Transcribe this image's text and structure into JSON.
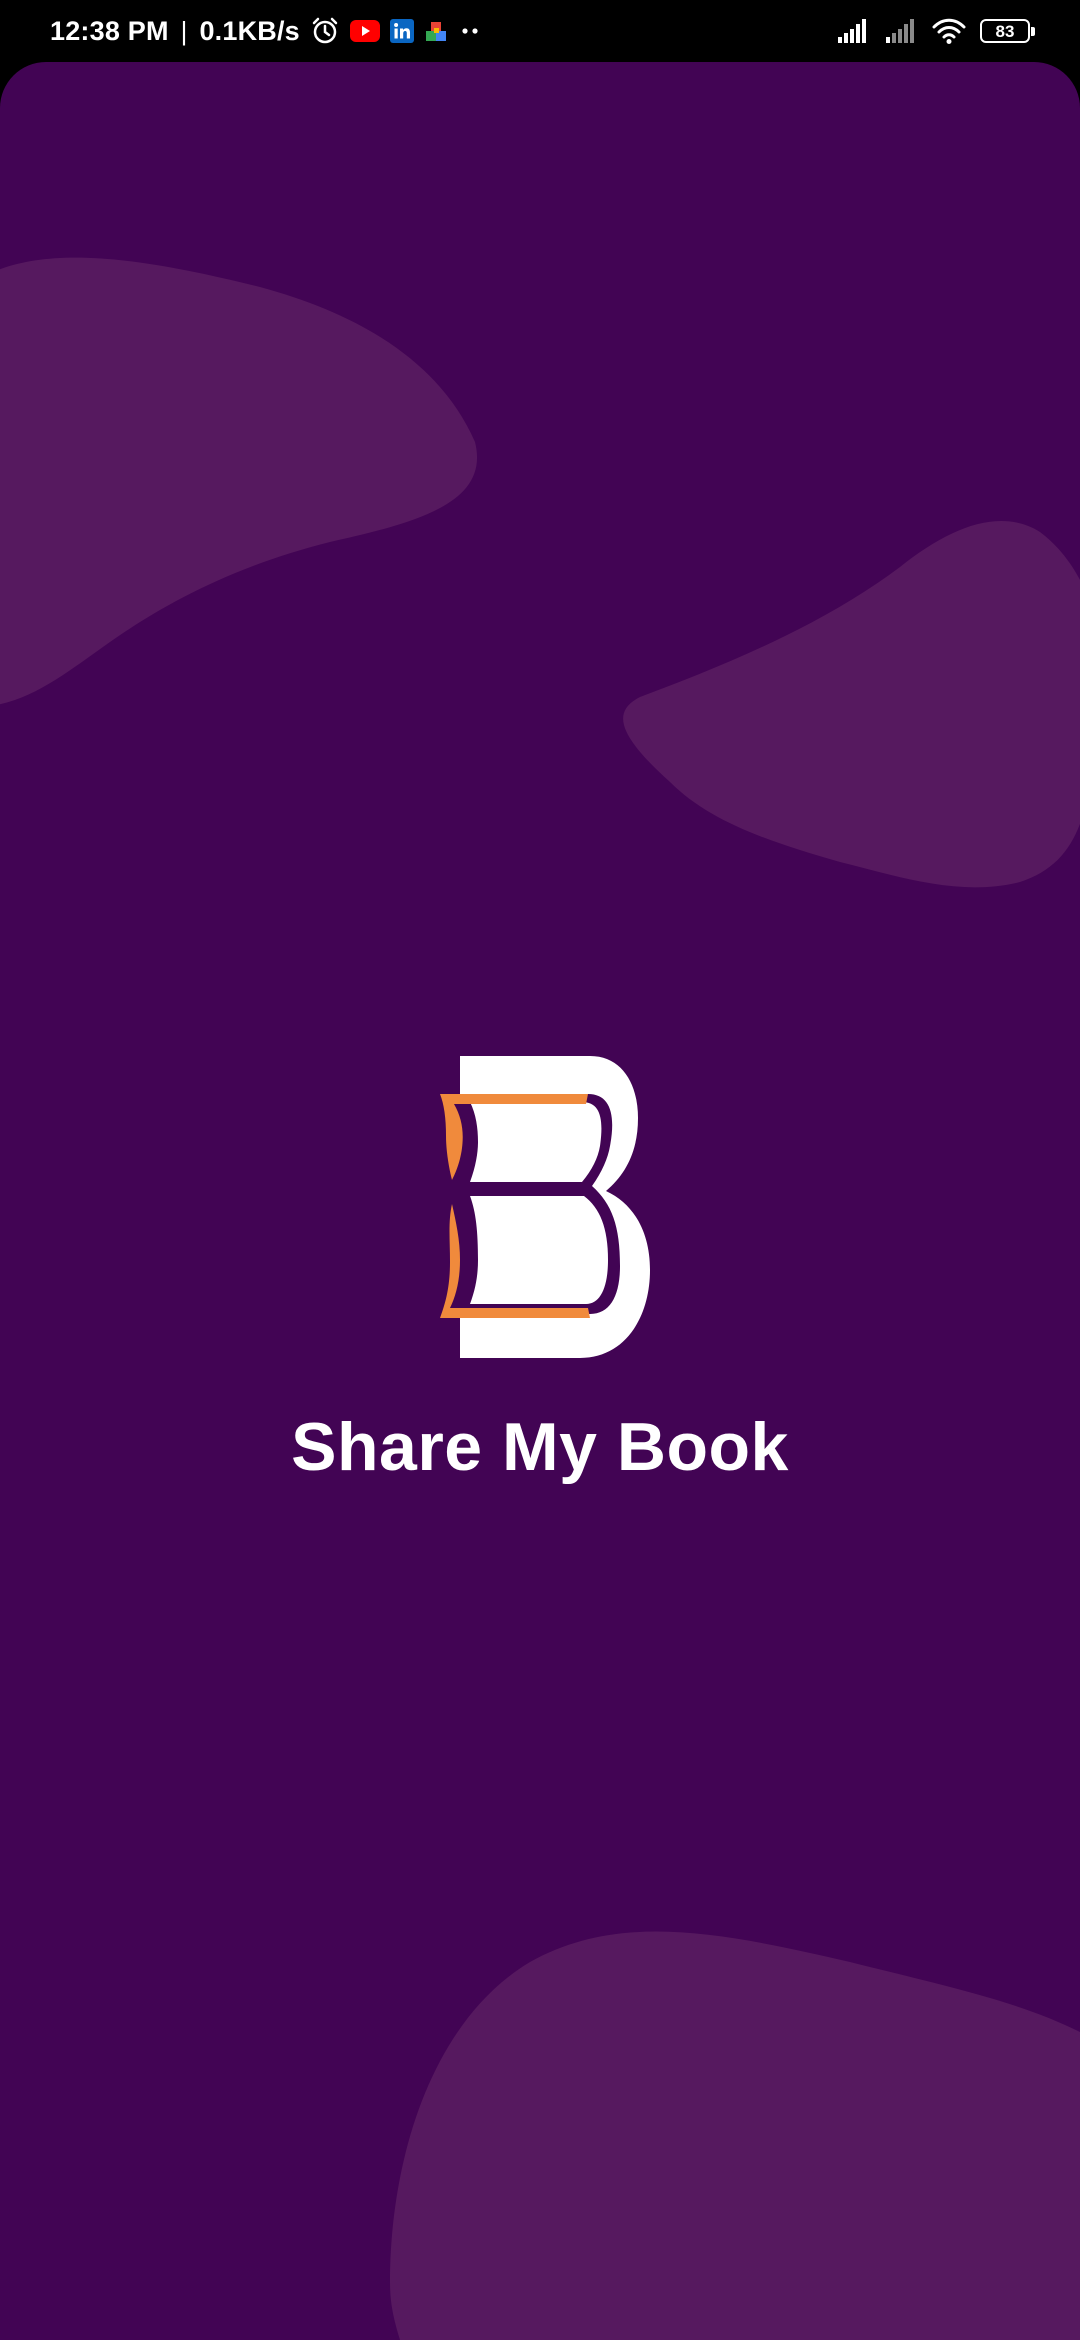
{
  "status_bar": {
    "time": "12:38 PM",
    "separator": "|",
    "network_speed": "0.1KB/s",
    "notification_icons": [
      "alarm-icon",
      "youtube-icon",
      "linkedin-icon",
      "puzzle-app-icon",
      "more-dots-icon"
    ],
    "right_icons": [
      "signal-icon",
      "signal-icon",
      "wifi-icon",
      "battery-icon"
    ],
    "battery_level": "83"
  },
  "splash": {
    "app_name": "Share My Book",
    "logo_icon": "book-b-logo-icon"
  },
  "colors": {
    "background": "#420454",
    "blob": "#56195F",
    "accent_orange": "#F08A3C",
    "text": "#FFFFFF"
  }
}
